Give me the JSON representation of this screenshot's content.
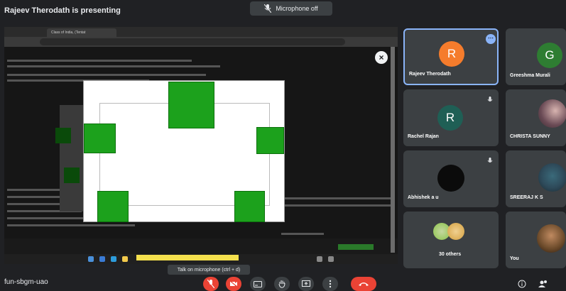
{
  "header": {
    "presenting": "Rajeev Therodath is presenting",
    "mic_status": "Microphone off"
  },
  "shared_screen": {
    "tab_label": "Class of India, (Tentat",
    "tooltip": "Talk on microphone (ctrl + d)",
    "diagram_boxes": [
      "",
      "",
      "",
      "",
      ""
    ]
  },
  "participants": [
    {
      "name": "Rajeev Therodath",
      "initial": "R",
      "avatar_color": "#f57c2c",
      "active": true
    },
    {
      "name": "Greeshma Murali",
      "initial": "G",
      "avatar_color": "#2e7d32",
      "active": false
    },
    {
      "name": "Rachel Rajan",
      "initial": "R",
      "avatar_color": "#1f5f55",
      "active": false
    },
    {
      "name": "CHRISTA SUNNY",
      "initial": "",
      "avatar_color": "#6a4a55",
      "active": false
    },
    {
      "name": "Abhishek a u",
      "initial": "",
      "avatar_color": "#111111",
      "active": false
    },
    {
      "name": "SREERAJ K S",
      "initial": "",
      "avatar_color": "#2e4a5a",
      "active": false
    },
    {
      "name": "30 others",
      "initial": "",
      "avatar_color": "#8bc34a",
      "active": false
    },
    {
      "name": "You",
      "initial": "",
      "avatar_color": "#6b4a2a",
      "active": false
    }
  ],
  "bottom": {
    "meeting_code": "fun-sbgm-uao"
  },
  "colors": {
    "end_call": "#ea4335",
    "control_gray": "#3c4043",
    "diagram_green": "#1ca11c"
  }
}
